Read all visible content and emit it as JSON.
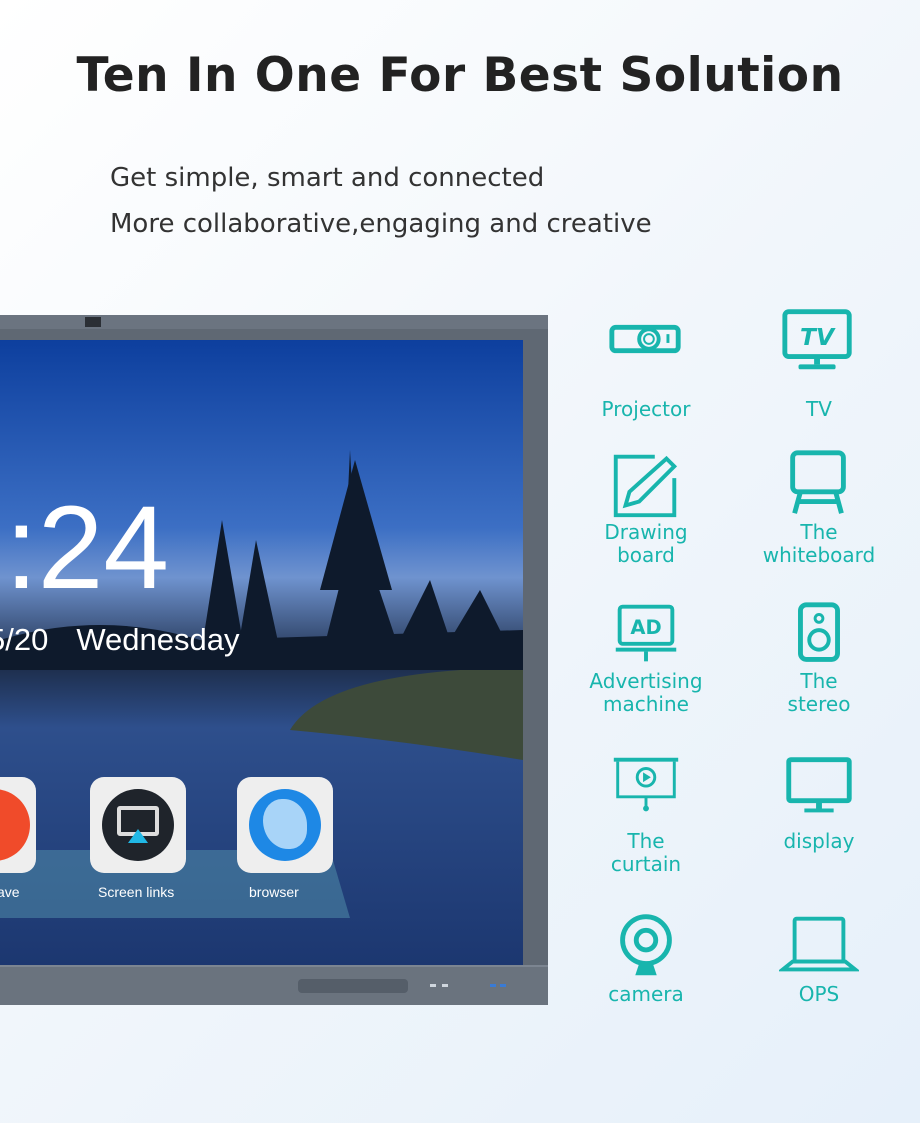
{
  "title": "Ten In One For Best Solution",
  "subtitle": [
    "Get simple, smart and connected",
    "More collaborative,engaging and creative"
  ],
  "screen": {
    "clock": ":24",
    "date": "5/20",
    "weekday": "Wednesday",
    "apps": [
      {
        "label": "save",
        "icon": "office-icon"
      },
      {
        "label": "Screen links",
        "icon": "screen-mirror-icon"
      },
      {
        "label": "browser",
        "icon": "globe-icon"
      }
    ]
  },
  "accent_color": "#18b5ad",
  "features": [
    {
      "label": [
        "Projector"
      ],
      "icon": "projector-icon"
    },
    {
      "label": [
        "TV"
      ],
      "icon": "tv-icon"
    },
    {
      "label": [
        "Drawing",
        "board"
      ],
      "icon": "drawing-board-icon"
    },
    {
      "label": [
        "The",
        "whiteboard"
      ],
      "icon": "whiteboard-icon"
    },
    {
      "label": [
        "Advertising",
        "machine"
      ],
      "icon": "ad-icon"
    },
    {
      "label": [
        "The",
        "stereo"
      ],
      "icon": "speaker-icon"
    },
    {
      "label": [
        "The",
        "curtain"
      ],
      "icon": "projection-screen-icon"
    },
    {
      "label": [
        "display"
      ],
      "icon": "monitor-icon"
    },
    {
      "label": [
        "camera"
      ],
      "icon": "webcam-icon"
    },
    {
      "label": [
        "OPS"
      ],
      "icon": "laptop-icon"
    }
  ]
}
